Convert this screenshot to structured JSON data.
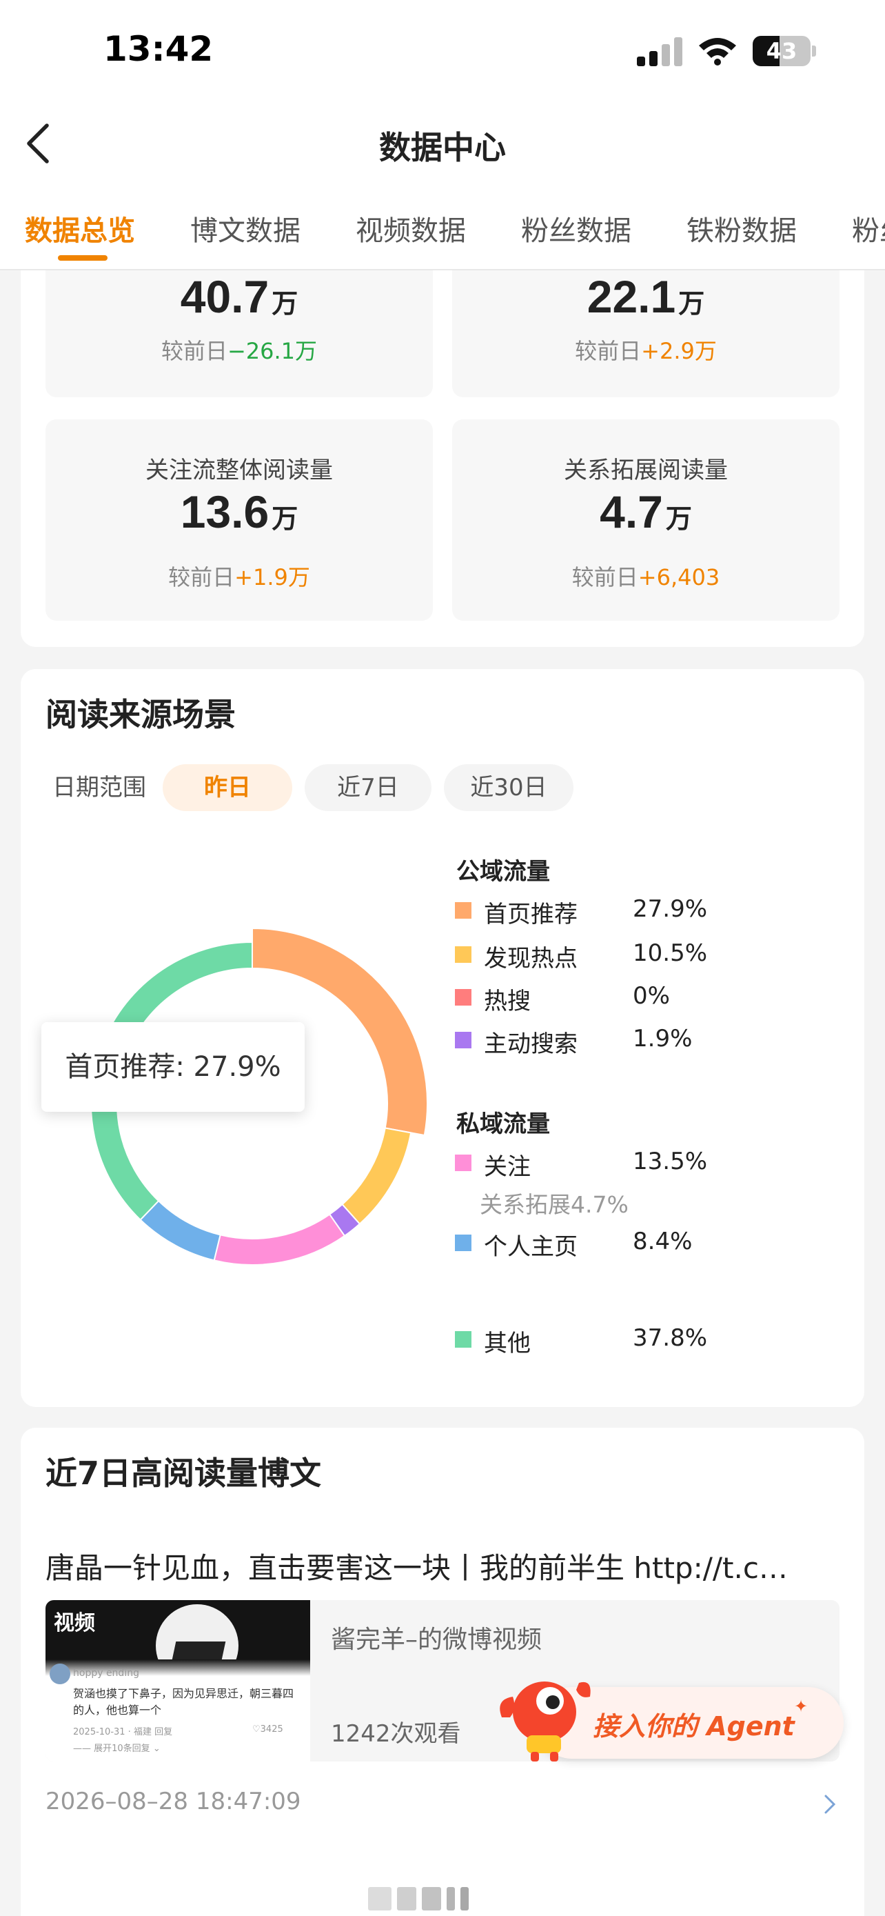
{
  "status_bar": {
    "time": "13:42",
    "battery": "43"
  },
  "header": {
    "title": "数据中心",
    "tabs": [
      "数据总览",
      "博文数据",
      "视频数据",
      "粉丝数据",
      "铁粉数据",
      "粉丝"
    ],
    "active_tab": 0
  },
  "overview": {
    "cards": [
      {
        "label": "",
        "value": "40.7",
        "unit": "万",
        "delta_prefix": "较前日",
        "delta": "−26.1万",
        "trend": "down"
      },
      {
        "label": "",
        "value": "22.1",
        "unit": "万",
        "delta_prefix": "较前日",
        "delta": "+2.9万",
        "trend": "up"
      },
      {
        "label": "关注流整体阅读量",
        "value": "13.6",
        "unit": "万",
        "delta_prefix": "较前日",
        "delta": "+1.9万",
        "trend": "up"
      },
      {
        "label": "关系拓展阅读量",
        "value": "4.7",
        "unit": "万",
        "delta_prefix": "较前日",
        "delta": "+6,403",
        "trend": "up"
      }
    ]
  },
  "read_source": {
    "title": "阅读来源场景",
    "date_label": "日期范围",
    "chips": [
      "昨日",
      "近7日",
      "近30日"
    ],
    "active_chip": 0,
    "tooltip": "首页推荐: 27.9%",
    "public_heading": "公域流量",
    "private_heading": "私域流量",
    "items": [
      {
        "label": "首页推荐",
        "pct": "27.9%",
        "value": 27.9,
        "color": "#ffa96b"
      },
      {
        "label": "发现热点",
        "pct": "10.5%",
        "value": 10.5,
        "color": "#ffc857"
      },
      {
        "label": "热搜",
        "pct": "0%",
        "value": 0,
        "color": "#ff7d7d"
      },
      {
        "label": "主动搜索",
        "pct": "1.9%",
        "value": 1.9,
        "color": "#a978f0"
      },
      {
        "label": "关注",
        "pct": "13.5%",
        "value": 13.5,
        "color": "#ff8fd8"
      },
      {
        "label": "个人主页",
        "pct": "8.4%",
        "value": 8.4,
        "color": "#6fb0ea"
      },
      {
        "label": "其他",
        "pct": "37.8%",
        "value": 37.8,
        "color": "#6edaa6"
      }
    ],
    "sub_note": "关系拓展4.7%"
  },
  "top_posts": {
    "title": "近7日高阅读量博文",
    "post": {
      "title": "唐晶一针见血，直击要害这一块丨我的前半生 http://t.c…",
      "thumb_badge": "视频",
      "thumb_user": "hoppy ending",
      "thumb_text": "贺涵也摸了下鼻子，因为见异思迁，朝三暮四的人，他也算一个",
      "thumb_meta": "2025-10-31 · 福建    回复",
      "thumb_likes": "3425",
      "thumb_more": "展开10条回复",
      "source": "酱完羊–的微博视频",
      "views": "1242次观看",
      "time": "2026–08–28 18:47:09"
    }
  },
  "agent_fab": {
    "label": "接入你的 Agent"
  }
}
